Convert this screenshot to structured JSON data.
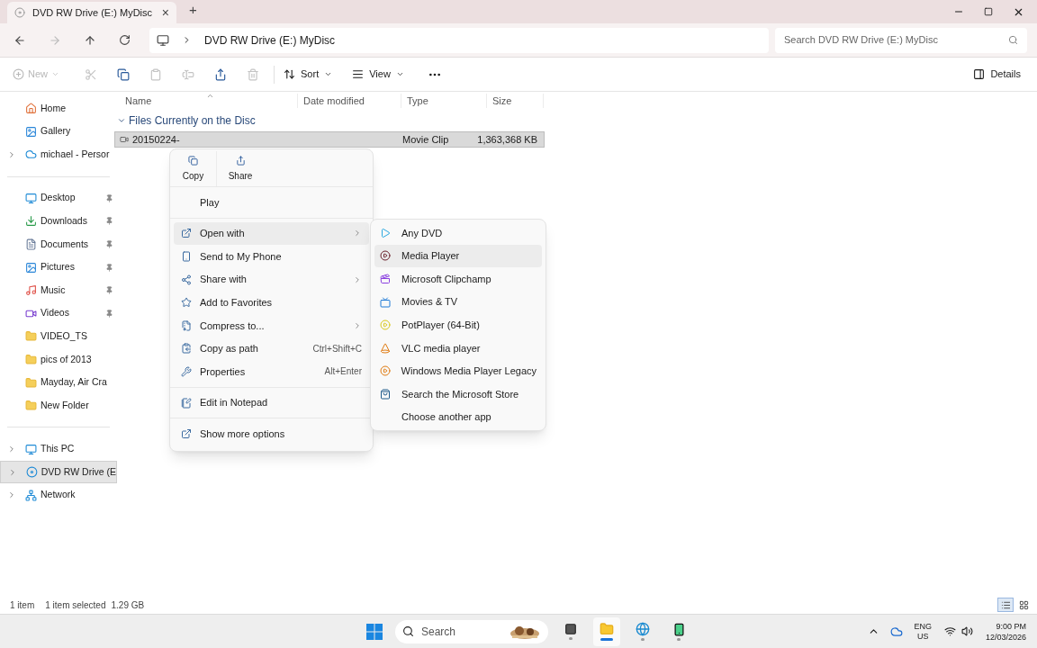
{
  "tab": {
    "title": "DVD RW Drive (E:) MyDisc",
    "close": "×",
    "new": "+"
  },
  "address": {
    "path": "DVD RW Drive (E:) MyDisc",
    "search_placeholder": "Search DVD RW Drive (E:) MyDisc"
  },
  "toolbar": {
    "new": {
      "label": "New",
      "disabled": true
    },
    "actions": [
      {
        "disabled": true
      },
      {
        "disabled": false
      },
      {
        "disabled": true
      },
      {
        "disabled": true
      },
      {
        "disabled": false
      },
      {
        "disabled": true
      }
    ],
    "sort": "Sort",
    "view": "View",
    "details": "Details"
  },
  "sidebar": {
    "top": [
      {
        "label": "Home",
        "expandable": false
      },
      {
        "label": "Gallery",
        "expandable": false
      },
      {
        "label": "michael - Persor",
        "expandable": true
      }
    ],
    "quick": [
      {
        "label": "Desktop",
        "pinned": true
      },
      {
        "label": "Downloads",
        "pinned": true
      },
      {
        "label": "Documents",
        "pinned": true
      },
      {
        "label": "Pictures",
        "pinned": true
      },
      {
        "label": "Music",
        "pinned": true
      },
      {
        "label": "Videos",
        "pinned": true
      },
      {
        "label": "VIDEO_TS",
        "pinned": false
      },
      {
        "label": "pics of 2013",
        "pinned": false
      },
      {
        "label": "Mayday, Air Cra",
        "pinned": false
      },
      {
        "label": "New Folder",
        "pinned": false
      }
    ],
    "drives": [
      {
        "label": "This PC",
        "selected": false
      },
      {
        "label": "DVD RW Drive (E",
        "selected": true
      },
      {
        "label": "Network",
        "selected": false
      }
    ]
  },
  "table": {
    "columns": [
      "Name",
      "Date modified",
      "Type",
      "Size"
    ],
    "group": "Files Currently on the Disc",
    "rows": [
      {
        "name": "20150224-",
        "type": "Movie Clip",
        "size": "1,363,368 KB",
        "selected": true
      }
    ]
  },
  "context_menu": {
    "quick_actions": [
      "Copy",
      "Share"
    ],
    "groups": [
      [
        {
          "label": "Play",
          "submenu": false,
          "selected": false
        }
      ],
      [
        {
          "label": "Open with",
          "submenu": true,
          "selected": true
        },
        {
          "label": "Send to My Phone",
          "submenu": false,
          "selected": false
        },
        {
          "label": "Share with",
          "submenu": true,
          "selected": false
        },
        {
          "label": "Add to Favorites",
          "submenu": false,
          "selected": false
        },
        {
          "label": "Compress to...",
          "submenu": true,
          "selected": false
        },
        {
          "label": "Copy as path",
          "shortcut": "Ctrl+Shift+C",
          "submenu": false,
          "selected": false
        },
        {
          "label": "Properties",
          "shortcut": "Alt+Enter",
          "submenu": false,
          "selected": false
        }
      ],
      [
        {
          "label": "Edit in Notepad",
          "submenu": false,
          "selected": false
        }
      ],
      [
        {
          "label": "Show more options",
          "submenu": false,
          "selected": false
        }
      ]
    ]
  },
  "open_with": [
    {
      "label": "Any DVD",
      "selected": false
    },
    {
      "label": "Media Player",
      "selected": true
    },
    {
      "label": "Microsoft Clipchamp",
      "selected": false
    },
    {
      "label": "Movies & TV",
      "selected": false
    },
    {
      "label": "PotPlayer (64-Bit)",
      "selected": false
    },
    {
      "label": "VLC media player",
      "selected": false
    },
    {
      "label": "Windows Media Player Legacy",
      "selected": false
    },
    {
      "label": "Search the Microsoft Store",
      "selected": false
    },
    {
      "label": "Choose another app",
      "selected": false
    }
  ],
  "status": {
    "count": "1 item",
    "selection": "1 item selected",
    "size": "1.29 GB",
    "views": [
      {
        "selected": true
      },
      {
        "selected": false
      }
    ]
  },
  "taskbar": {
    "search_placeholder": "Search",
    "apps": [
      {
        "selected": false
      },
      {
        "selected": true
      },
      {
        "selected": false
      },
      {
        "selected": false
      }
    ],
    "language": "ENG",
    "region": "US",
    "time": "9:00 PM",
    "date": "12/03/2026"
  }
}
